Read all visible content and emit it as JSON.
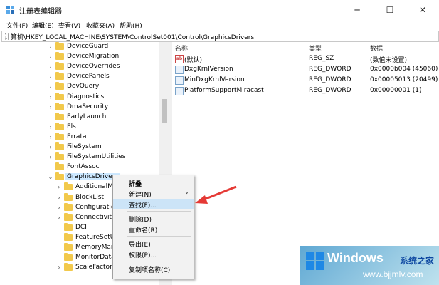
{
  "window": {
    "title": "注册表编辑器",
    "minimize": "─",
    "maximize": "☐",
    "close": "✕"
  },
  "menubar": [
    "文件(F)",
    "编辑(E)",
    "查看(V)",
    "收藏夹(A)",
    "帮助(H)"
  ],
  "address": "计算机\\HKEY_LOCAL_MACHINE\\SYSTEM\\ControlSet001\\Control\\GraphicsDrivers",
  "tree": [
    {
      "label": "DeviceGuard",
      "chevron": "›"
    },
    {
      "label": "DeviceMigration",
      "chevron": "›"
    },
    {
      "label": "DeviceOverrides",
      "chevron": "›"
    },
    {
      "label": "DevicePanels",
      "chevron": "›"
    },
    {
      "label": "DevQuery",
      "chevron": "›"
    },
    {
      "label": "Diagnostics",
      "chevron": "›"
    },
    {
      "label": "DmaSecurity",
      "chevron": "›"
    },
    {
      "label": "EarlyLaunch",
      "chevron": ""
    },
    {
      "label": "Els",
      "chevron": "›"
    },
    {
      "label": "Errata",
      "chevron": "›"
    },
    {
      "label": "FileSystem",
      "chevron": "›"
    },
    {
      "label": "FileSystemUtilities",
      "chevron": "›"
    },
    {
      "label": "FontAssoc",
      "chevron": ""
    },
    {
      "label": "GraphicsDrivers",
      "chevron": "⌄",
      "selected": true
    },
    {
      "label": "AdditionalMo",
      "chevron": "›",
      "child": true
    },
    {
      "label": "BlockList",
      "chevron": "›",
      "child": true
    },
    {
      "label": "Configuration",
      "chevron": "›",
      "child": true
    },
    {
      "label": "Connectivity",
      "chevron": "›",
      "child": true
    },
    {
      "label": "DCI",
      "chevron": "",
      "child": true
    },
    {
      "label": "FeatureSetUs",
      "chevron": "",
      "child": true
    },
    {
      "label": "MemoryMan",
      "chevron": "",
      "child": true
    },
    {
      "label": "MonitorDataS",
      "chevron": "",
      "child": true
    },
    {
      "label": "ScaleFactors",
      "chevron": "›",
      "child": true
    }
  ],
  "columns": {
    "name": "名称",
    "type": "类型",
    "data": "数据"
  },
  "values": [
    {
      "name": "(默认)",
      "type": "REG_SZ",
      "data": "(数值未设置)",
      "icon": "ab"
    },
    {
      "name": "DxgKrnlVersion",
      "type": "REG_DWORD",
      "data": "0x0000b004 (45060)",
      "icon": "bin"
    },
    {
      "name": "MinDxgKrnlVersion",
      "type": "REG_DWORD",
      "data": "0x00005013 (20499)",
      "icon": "bin"
    },
    {
      "name": "PlatformSupportMiracast",
      "type": "REG_DWORD",
      "data": "0x00000001 (1)",
      "icon": "bin"
    }
  ],
  "context_menu": {
    "collapse": "折叠",
    "new": "新建(N)",
    "new_arrow": "›",
    "find": "查找(F)...",
    "delete": "删除(D)",
    "rename": "重命名(R)",
    "export": "导出(E)",
    "permissions": "权限(P)...",
    "copy_key_name": "复制项名称(C)"
  },
  "watermark": {
    "brand": "Windows",
    "brand_cn": "系统之家",
    "url": "www.bjjmlv.com"
  },
  "colors": {
    "selection": "#cce8ff",
    "menu_highlight": "#cce4f7",
    "arrow": "#e53935",
    "folder": "#f2c94c"
  }
}
